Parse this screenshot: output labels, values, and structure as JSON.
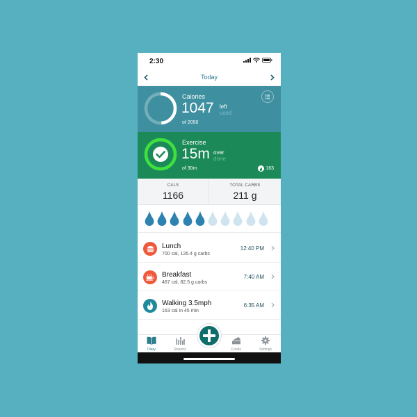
{
  "status_bar": {
    "time": "2:30"
  },
  "header": {
    "date_label": "Today"
  },
  "calories": {
    "title": "Calories",
    "value": "1047",
    "left_label": "left",
    "used_label": "used",
    "of_text": "of 2050",
    "progress_fraction": 0.49,
    "ring_color": "#ffffff",
    "card_color": "#3e8f9f"
  },
  "exercise": {
    "title": "Exercise",
    "value": "15m",
    "over_label": "over",
    "done_label": "done",
    "of_text": "of 30m",
    "burned": "163",
    "progress_fraction": 1.0,
    "ring_color": "#3ee03e",
    "card_color": "#1c8a58"
  },
  "stats": [
    {
      "label": "CALS",
      "value": "1166"
    },
    {
      "label": "TOTAL CARBS",
      "value": "211 g"
    }
  ],
  "water": {
    "total_drops": 10,
    "filled_drops": 5,
    "filled_color": "#2e82b0",
    "empty_color": "#cfe4ef"
  },
  "entries": [
    {
      "name": "Lunch",
      "detail": "700 cal, 126.4 g carbs",
      "time": "12:40 PM",
      "icon": "burger-icon",
      "icon_color": "#ef5a3c"
    },
    {
      "name": "Breakfast",
      "detail": "467 cal, 82.5 g carbs",
      "time": "7:40 AM",
      "icon": "coffee-cup-icon",
      "icon_color": "#ef5a3c"
    },
    {
      "name": "Walking 3.5mph",
      "detail": "163 cal in 45 min",
      "time": "6:35 AM",
      "icon": "flame-icon",
      "icon_color": "#1f8a9a"
    }
  ],
  "tabs": [
    {
      "label": "Diary",
      "icon": "book-icon",
      "active": true
    },
    {
      "label": "Reports",
      "icon": "bar-chart-icon",
      "active": false
    },
    {
      "label": "Foods",
      "icon": "cake-icon",
      "active": false
    },
    {
      "label": "Settings",
      "icon": "gear-icon",
      "active": false
    }
  ],
  "add_button": {
    "icon": "plus-icon",
    "color": "#0f6e6a"
  }
}
